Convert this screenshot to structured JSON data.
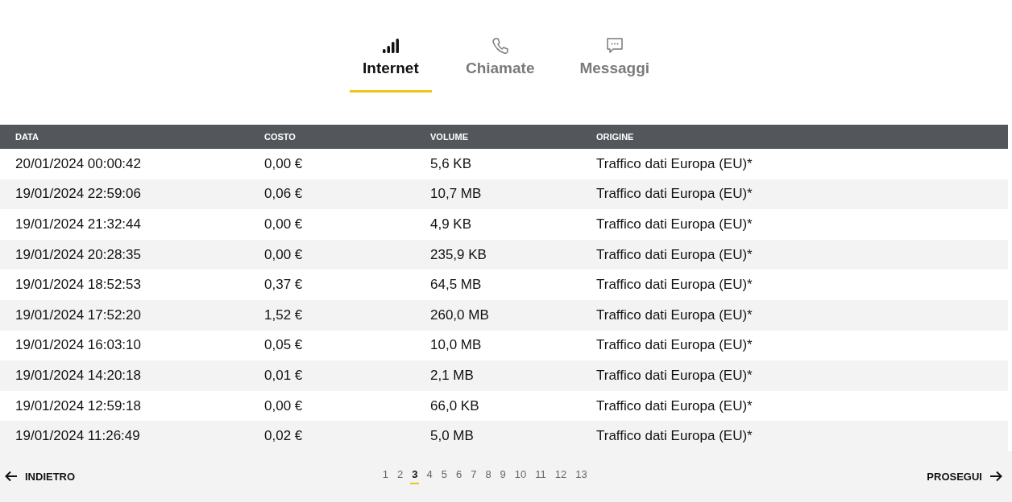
{
  "tabs": [
    {
      "label": "Internet",
      "kind": "signal",
      "selected": true
    },
    {
      "label": "Chiamate",
      "kind": "phone",
      "selected": false
    },
    {
      "label": "Messaggi",
      "kind": "chat",
      "selected": false
    }
  ],
  "table": {
    "columns": [
      "DATA",
      "COSTO",
      "VOLUME",
      "ORIGINE"
    ],
    "rows": [
      [
        "20/01/2024 00:00:42",
        "0,00 €",
        "5,6 KB",
        "Traffico dati Europa (EU)*"
      ],
      [
        "19/01/2024 22:59:06",
        "0,06 €",
        "10,7 MB",
        "Traffico dati Europa (EU)*"
      ],
      [
        "19/01/2024 21:32:44",
        "0,00 €",
        "4,9 KB",
        "Traffico dati Europa (EU)*"
      ],
      [
        "19/01/2024 20:28:35",
        "0,00 €",
        "235,9 KB",
        "Traffico dati Europa (EU)*"
      ],
      [
        "19/01/2024 18:52:53",
        "0,37 €",
        "64,5 MB",
        "Traffico dati Europa (EU)*"
      ],
      [
        "19/01/2024 17:52:20",
        "1,52 €",
        "260,0 MB",
        "Traffico dati Europa (EU)*"
      ],
      [
        "19/01/2024 16:03:10",
        "0,05 €",
        "10,0 MB",
        "Traffico dati Europa (EU)*"
      ],
      [
        "19/01/2024 14:20:18",
        "0,01 €",
        "2,1 MB",
        "Traffico dati Europa (EU)*"
      ],
      [
        "19/01/2024 12:59:18",
        "0,00 €",
        "66,0 KB",
        "Traffico dati Europa (EU)*"
      ],
      [
        "19/01/2024 11:26:49",
        "0,02 €",
        "5,0 MB",
        "Traffico dati Europa (EU)*"
      ]
    ]
  },
  "pagination": {
    "back": "INDIETRO",
    "next": "PROSEGUI",
    "pages": [
      {
        "label": "1",
        "selected": false
      },
      {
        "label": "2",
        "selected": false
      },
      {
        "label": "3",
        "selected": true
      },
      {
        "label": "4",
        "selected": false
      },
      {
        "label": "5",
        "selected": false
      },
      {
        "label": "6",
        "selected": false
      },
      {
        "label": "7",
        "selected": false
      },
      {
        "label": "8",
        "selected": false
      },
      {
        "label": "9",
        "selected": false
      },
      {
        "label": "10",
        "selected": false
      },
      {
        "label": "11",
        "selected": false
      },
      {
        "label": "12",
        "selected": false
      },
      {
        "label": "13",
        "selected": false
      }
    ]
  }
}
